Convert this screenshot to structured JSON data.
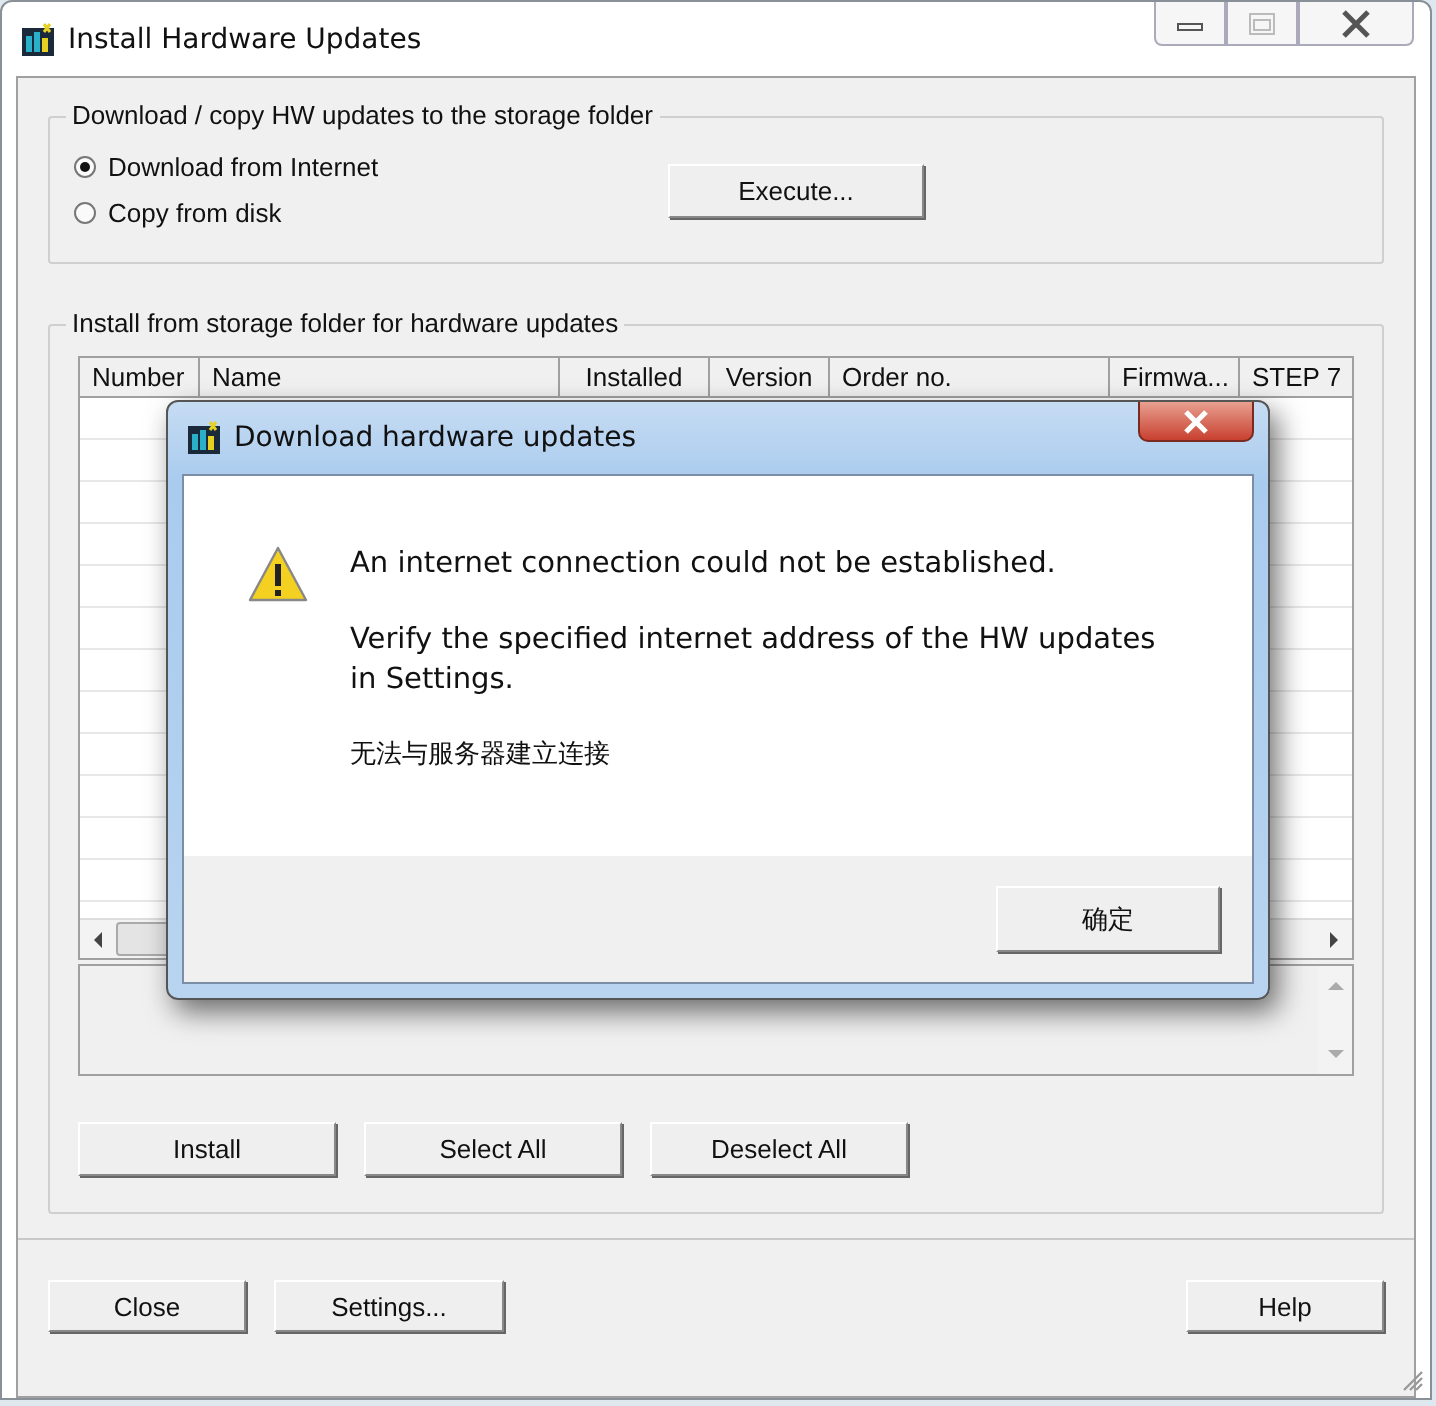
{
  "window": {
    "title": "Install Hardware Updates"
  },
  "download_group": {
    "title": "Download / copy HW updates to the storage folder",
    "options": [
      {
        "label": "Download from Internet",
        "selected": true
      },
      {
        "label": "Copy from disk",
        "selected": false
      }
    ],
    "execute_button": "Execute..."
  },
  "install_group": {
    "title": "Install from storage folder for hardware updates",
    "table": {
      "columns": [
        "Number",
        "Name",
        "Installed",
        "Version",
        "Order no.",
        "Firmwa...",
        "STEP 7"
      ]
    },
    "buttons": [
      "Install",
      "Select All",
      "Deselect All"
    ]
  },
  "footer_buttons": {
    "left": [
      "Close",
      "Settings..."
    ],
    "right": [
      "Help"
    ]
  },
  "dialog": {
    "title": "Download hardware updates",
    "messages": [
      "An internet connection could not be established.",
      "Verify the specified internet address of the HW updates in Settings.",
      "无法与服务器建立连接"
    ],
    "ok_button": "确定"
  }
}
